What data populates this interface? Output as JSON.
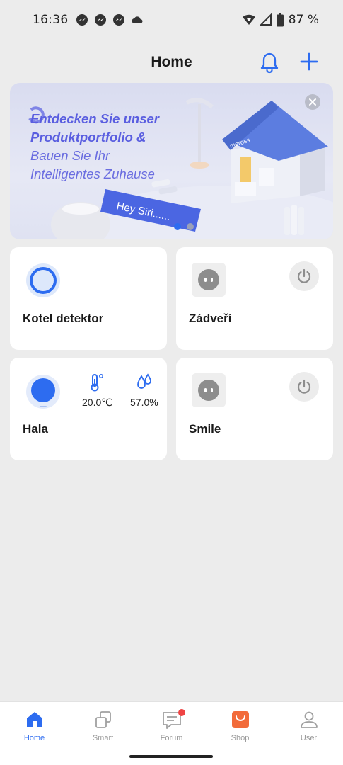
{
  "status_bar": {
    "time": "16:36",
    "battery": "87 %"
  },
  "header": {
    "title": "Home"
  },
  "banner": {
    "line1": "Entdecken Sie unser",
    "line2": "Produktportfolio &",
    "line3": "Bauen Sie Ihr",
    "line4": "Intelligentes Zuhause",
    "siri_tag": "Hey Siri......",
    "brand": "meross"
  },
  "devices": [
    {
      "name": "Kotel detektor",
      "type": "detector"
    },
    {
      "name": "Zádveří",
      "type": "plug"
    },
    {
      "name": "Hala",
      "type": "sensor",
      "temperature": "20.0℃",
      "humidity": "57.0%"
    },
    {
      "name": "Smile",
      "type": "plug"
    }
  ],
  "bottom_nav": {
    "items": [
      {
        "label": "Home",
        "icon": "home-icon",
        "active": true
      },
      {
        "label": "Smart",
        "icon": "smart-icon",
        "active": false
      },
      {
        "label": "Forum",
        "icon": "forum-icon",
        "active": false
      },
      {
        "label": "Shop",
        "icon": "shop-icon",
        "active": false
      },
      {
        "label": "User",
        "icon": "user-icon",
        "active": false
      }
    ]
  },
  "colors": {
    "accent": "#2d6cf0",
    "banner_text": "#5a5ee0",
    "shop": "#f26b3a",
    "badge": "#ef4444"
  }
}
